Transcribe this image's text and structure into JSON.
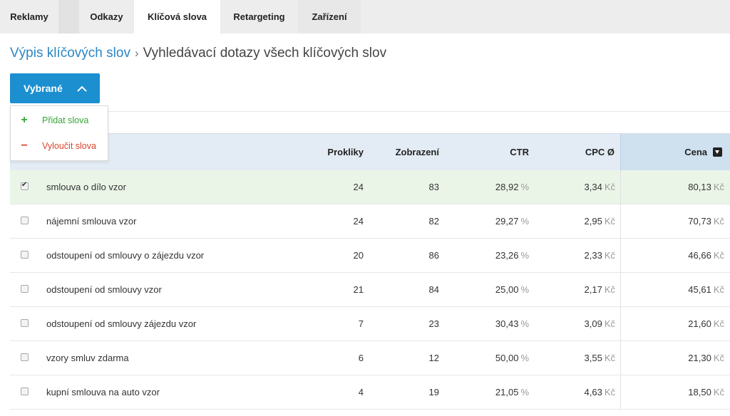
{
  "tabs": [
    "Reklamy",
    "Odkazy",
    "Klíčová slova",
    "Retargeting",
    "Zařízení"
  ],
  "breadcrumb": {
    "link": "Výpis klíčových slov",
    "separator": "›",
    "current": "Vyhledávací dotazy všech klíčových slov"
  },
  "selected_button": {
    "label": "Vybrané",
    "icon": "chevron-up-icon"
  },
  "dropdown": {
    "add": {
      "symbol": "+",
      "label": "Přidat slova"
    },
    "remove": {
      "symbol": "−",
      "label": "Vyloučit slova"
    }
  },
  "columns": {
    "prokliky": "Prokliky",
    "zobrazeni": "Zobrazení",
    "ctr": "CTR",
    "cpc": "CPC Ø",
    "cena": "Cena"
  },
  "units": {
    "percent": "%",
    "currency": "Kč"
  },
  "rows": [
    {
      "checked": true,
      "keyword": "smlouva o dílo vzor",
      "prokliky": "24",
      "zobrazeni": "83",
      "ctr": "28,92",
      "cpc": "3,34",
      "cena": "80,13"
    },
    {
      "checked": false,
      "keyword": "nájemní smlouva vzor",
      "prokliky": "24",
      "zobrazeni": "82",
      "ctr": "29,27",
      "cpc": "2,95",
      "cena": "70,73"
    },
    {
      "checked": false,
      "keyword": "odstoupení od smlouvy o zájezdu vzor",
      "prokliky": "20",
      "zobrazeni": "86",
      "ctr": "23,26",
      "cpc": "2,33",
      "cena": "46,66"
    },
    {
      "checked": false,
      "keyword": "odstoupení od smlouvy vzor",
      "prokliky": "21",
      "zobrazeni": "84",
      "ctr": "25,00",
      "cpc": "2,17",
      "cena": "45,61"
    },
    {
      "checked": false,
      "keyword": "odstoupení od smlouvy zájezdu vzor",
      "prokliky": "7",
      "zobrazeni": "23",
      "ctr": "30,43",
      "cpc": "3,09",
      "cena": "21,60"
    },
    {
      "checked": false,
      "keyword": "vzory smluv zdarma",
      "prokliky": "6",
      "zobrazeni": "12",
      "ctr": "50,00",
      "cpc": "3,55",
      "cena": "21,30"
    },
    {
      "checked": false,
      "keyword": "kupní smlouva na auto vzor",
      "prokliky": "4",
      "zobrazeni": "19",
      "ctr": "21,05",
      "cpc": "4,63",
      "cena": "18,50"
    }
  ],
  "colors": {
    "accent": "#1b8fd0",
    "link": "#2b86c5",
    "add": "#35a637",
    "remove": "#d9452f",
    "selected_row": "#eaf5e8",
    "header": "#e3ecf4"
  }
}
